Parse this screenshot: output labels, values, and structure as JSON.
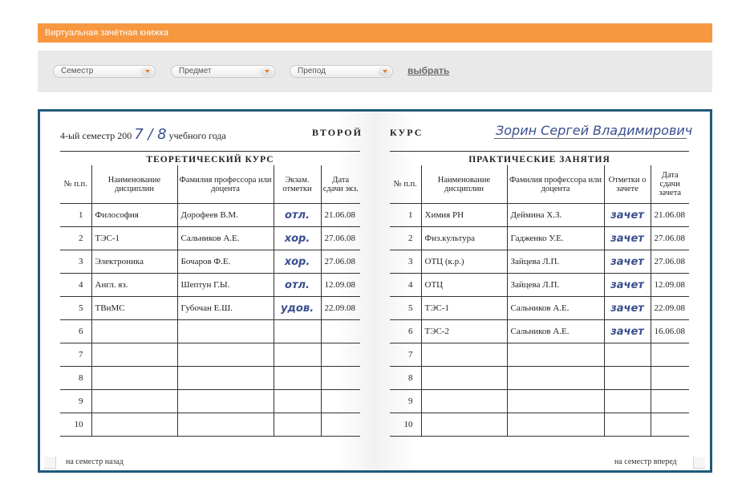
{
  "header": {
    "title": "Виртуальная зачётная книжка"
  },
  "filters": {
    "semester": "Семестр",
    "subject": "Предмет",
    "teacher": "Препод",
    "submit": "выбрать"
  },
  "book": {
    "semester_label": "4-ый семестр 200",
    "year_hand": "7 / 8",
    "year_suffix": "учебного года",
    "course_word_1": "ВТОРОЙ",
    "course_word_2": "КУРС",
    "student_name": "Зорин Сергей Владимирович",
    "left": {
      "title": "ТЕОРЕТИЧЕСКИЙ КУРС",
      "columns": [
        "№ п.п.",
        "Наименование дисциплин",
        "Фамилия профессора или доцента",
        "Экзам. отметки",
        "Дата сдачи экз."
      ],
      "rows": [
        {
          "n": "1",
          "subject": "Философия",
          "teacher": "Дорофеев В.М.",
          "mark": "отл.",
          "date": "21.06.08"
        },
        {
          "n": "2",
          "subject": "ТЭС-1",
          "teacher": "Сальников А.Е.",
          "mark": "хор.",
          "date": "27.06.08"
        },
        {
          "n": "3",
          "subject": "Электроника",
          "teacher": "Бочаров Ф.Е.",
          "mark": "хор.",
          "date": "27.06.08"
        },
        {
          "n": "4",
          "subject": "Англ. яз.",
          "teacher": "Шептун Г.Ы.",
          "mark": "отл.",
          "date": "12.09.08"
        },
        {
          "n": "5",
          "subject": "ТВиМС",
          "teacher": "Губочан Е.Ш.",
          "mark": "удов.",
          "date": "22.09.08"
        },
        {
          "n": "6",
          "subject": "",
          "teacher": "",
          "mark": "",
          "date": ""
        },
        {
          "n": "7",
          "subject": "",
          "teacher": "",
          "mark": "",
          "date": ""
        },
        {
          "n": "8",
          "subject": "",
          "teacher": "",
          "mark": "",
          "date": ""
        },
        {
          "n": "9",
          "subject": "",
          "teacher": "",
          "mark": "",
          "date": ""
        },
        {
          "n": "10",
          "subject": "",
          "teacher": "",
          "mark": "",
          "date": ""
        }
      ],
      "nav": "на семестр назад"
    },
    "right": {
      "title": "ПРАКТИЧЕСКИЕ ЗАНЯТИЯ",
      "columns": [
        "№ п.п.",
        "Наименование дисциплин",
        "Фамилия профессора или доцента",
        "Отметки о зачете",
        "Дата сдачи зачета"
      ],
      "rows": [
        {
          "n": "1",
          "subject": "Химия РН",
          "teacher": "Деймина Х.З.",
          "mark": "зачет",
          "date": "21.06.08"
        },
        {
          "n": "2",
          "subject": "Физ.культура",
          "teacher": "Гадженко У.Е.",
          "mark": "зачет",
          "date": "27.06.08"
        },
        {
          "n": "3",
          "subject": "ОТЦ (к.р.)",
          "teacher": "Зайцева Л.П.",
          "mark": "зачет",
          "date": "27.06.08"
        },
        {
          "n": "4",
          "subject": "ОТЦ",
          "teacher": "Зайцева Л.П.",
          "mark": "зачет",
          "date": "12.09.08"
        },
        {
          "n": "5",
          "subject": "ТЭС-1",
          "teacher": "Сальников А.Е.",
          "mark": "зачет",
          "date": "22.09.08"
        },
        {
          "n": "6",
          "subject": "ТЭС-2",
          "teacher": "Сальников А.Е.",
          "mark": "зачет",
          "date": "16.06.08"
        },
        {
          "n": "7",
          "subject": "",
          "teacher": "",
          "mark": "",
          "date": ""
        },
        {
          "n": "8",
          "subject": "",
          "teacher": "",
          "mark": "",
          "date": ""
        },
        {
          "n": "9",
          "subject": "",
          "teacher": "",
          "mark": "",
          "date": ""
        },
        {
          "n": "10",
          "subject": "",
          "teacher": "",
          "mark": "",
          "date": ""
        }
      ],
      "nav": "на семестр вперед"
    }
  }
}
